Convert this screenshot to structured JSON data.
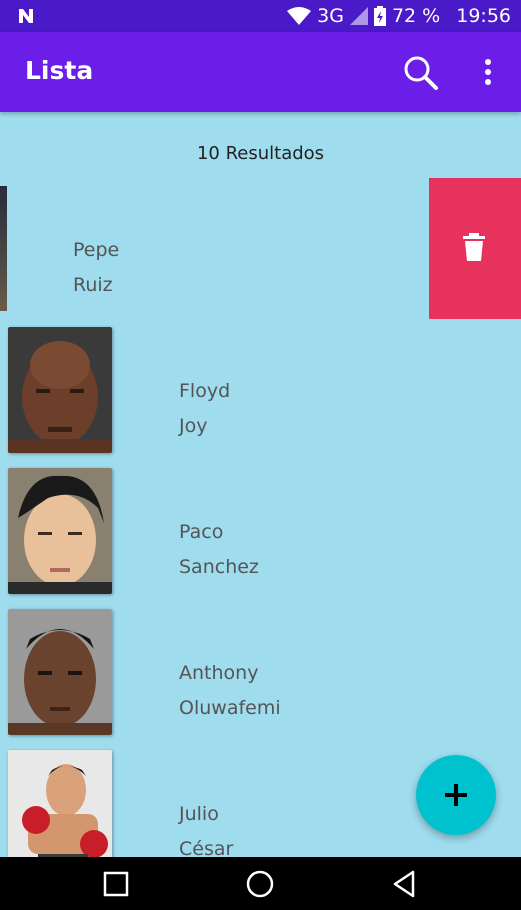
{
  "status_bar": {
    "network": "3G",
    "battery": "72 %",
    "time": "19:56",
    "icons": [
      "notification-n-icon",
      "wifi-icon",
      "signal-icon",
      "battery-charging-icon"
    ]
  },
  "app_bar": {
    "title": "Lista",
    "actions": [
      "search-icon",
      "more-vert-icon"
    ]
  },
  "results_label": "10 Resultados",
  "items": [
    {
      "first": "Pepe",
      "last": "Ruiz",
      "swiped": true
    },
    {
      "first": "Floyd",
      "last": "Joy"
    },
    {
      "first": "Paco",
      "last": "Sanchez"
    },
    {
      "first": "Anthony",
      "last": "Oluwafemi"
    },
    {
      "first": "Julio",
      "last": "César"
    }
  ],
  "swipe_action": {
    "icon": "trash-icon",
    "color": "#e8325e"
  },
  "fab": {
    "icon": "plus-icon",
    "color": "#00c2cf"
  },
  "nav_bar": {
    "buttons": [
      "recents-square-icon",
      "home-circle-icon",
      "back-triangle-icon"
    ]
  },
  "colors": {
    "app_bar": "#6a1ee8",
    "status_bar": "#4a19c8",
    "background": "#9edcee"
  }
}
